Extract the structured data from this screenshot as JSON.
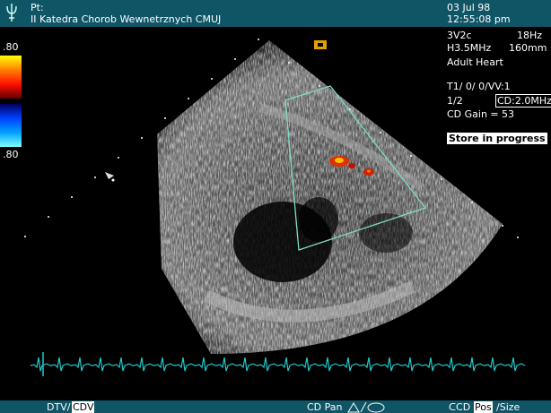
{
  "header": {
    "patient_label": "Pt:",
    "institution": "II Katedra Chorob Wewnetrznych CMUJ",
    "date": "03 Jul 98",
    "time": "12:55:08 pm",
    "logo_icon": "trident-logo-icon"
  },
  "probe": {
    "transducer": "3V2c",
    "frame_rate": "18Hz",
    "frequency": "H3.5MHz",
    "depth": "160mm",
    "preset": "Adult Heart"
  },
  "settings": {
    "line1": "T1/ 0/ 0/VV:1",
    "line2_left": "1/2",
    "cd_freq": "CD:2.0MHz",
    "cd_gain_label": "CD Gain =",
    "cd_gain_value": "53"
  },
  "status": {
    "store": "Store in progress"
  },
  "color_scale": {
    "top_value": ".80",
    "bottom_value": ".80",
    "colors": {
      "positive": [
        "#ffff00",
        "#ff8000",
        "#ff1000",
        "#600000"
      ],
      "negative": [
        "#000060",
        "#0040ff",
        "#00a0ff",
        "#80ffff"
      ]
    }
  },
  "ecg": {
    "color": "#20c8c8"
  },
  "roi": {
    "color": "#7fdcc8"
  },
  "footer": {
    "dtv": "DTV/",
    "cdv": "CDV",
    "cd_pan": "CD Pan",
    "pan_icons": "triangle-icon, ellipse-icon",
    "cd_pos_prefix": "ᑕCD",
    "pos": "Pos",
    "size": "/Size"
  }
}
